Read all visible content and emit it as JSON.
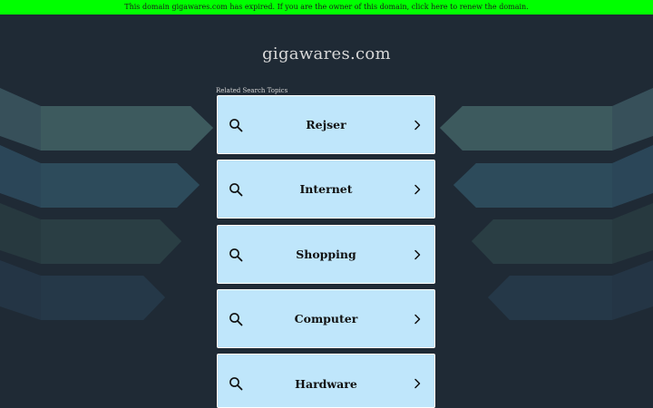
{
  "banner": {
    "text": "This domain gigawares.com has expired. If you are the owner of this domain, click here to renew the domain."
  },
  "site": {
    "title": "gigawares.com"
  },
  "related": {
    "label": "Related Search Topics",
    "items": [
      {
        "label": "Rejser"
      },
      {
        "label": "Internet"
      },
      {
        "label": "Shopping"
      },
      {
        "label": "Computer"
      },
      {
        "label": "Hardware"
      }
    ]
  },
  "colors": {
    "background": "#1f2a35",
    "banner": "#00ff00",
    "card": "#bfe6fb"
  },
  "icons": {
    "search": "search-icon",
    "chevron": "chevron-right-icon"
  }
}
